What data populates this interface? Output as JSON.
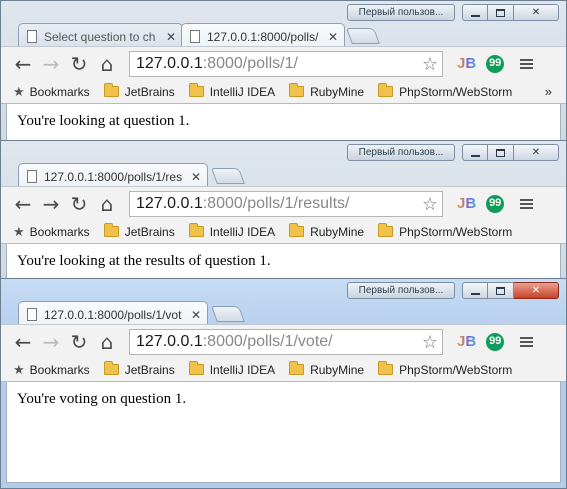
{
  "windows": [
    {
      "user_badge": "Первый пользов...",
      "tabs": [
        {
          "label": "Select question to ch",
          "active": false
        },
        {
          "label": "127.0.0.1:8000/polls/",
          "active": true
        }
      ],
      "url_host": "127.0.0.1",
      "url_rest": ":8000/polls/1/",
      "content": "You're looking at question 1."
    },
    {
      "user_badge": "Первый пользов...",
      "tabs": [
        {
          "label": "127.0.0.1:8000/polls/1/res",
          "active": true
        }
      ],
      "url_host": "127.0.0.1",
      "url_rest": ":8000/polls/1/results/",
      "content": "You're looking at the results of question 1."
    },
    {
      "user_badge": "Первый пользов...",
      "tabs": [
        {
          "label": "127.0.0.1:8000/polls/1/vot",
          "active": true
        }
      ],
      "url_host": "127.0.0.1",
      "url_rest": ":8000/polls/1/vote/",
      "content": "You're voting on question 1."
    }
  ],
  "bookmarks": [
    "Bookmarks",
    "JetBrains",
    "IntelliJ IDEA",
    "RubyMine",
    "PhpStorm/WebStorm"
  ],
  "bookmarks_overflow": "»",
  "extensions": {
    "jb_label": "JB",
    "hangouts_label": "99"
  },
  "window_controls": {
    "close_glyph": "✕"
  },
  "icons": {
    "back": "back-arrow-icon",
    "forward": "forward-arrow-icon",
    "reload": "reload-icon",
    "home": "home-icon",
    "star": "bookmark-star-icon",
    "menu": "hamburger-menu-icon",
    "folder": "folder-icon",
    "tab_page": "page-document-icon"
  },
  "colors": {
    "active_frame": "#b9d2ef",
    "inactive_frame": "#d8e0e9",
    "close_button": "#c8432a",
    "hangouts": "#0f9d58",
    "folder": "#f0c24a"
  }
}
